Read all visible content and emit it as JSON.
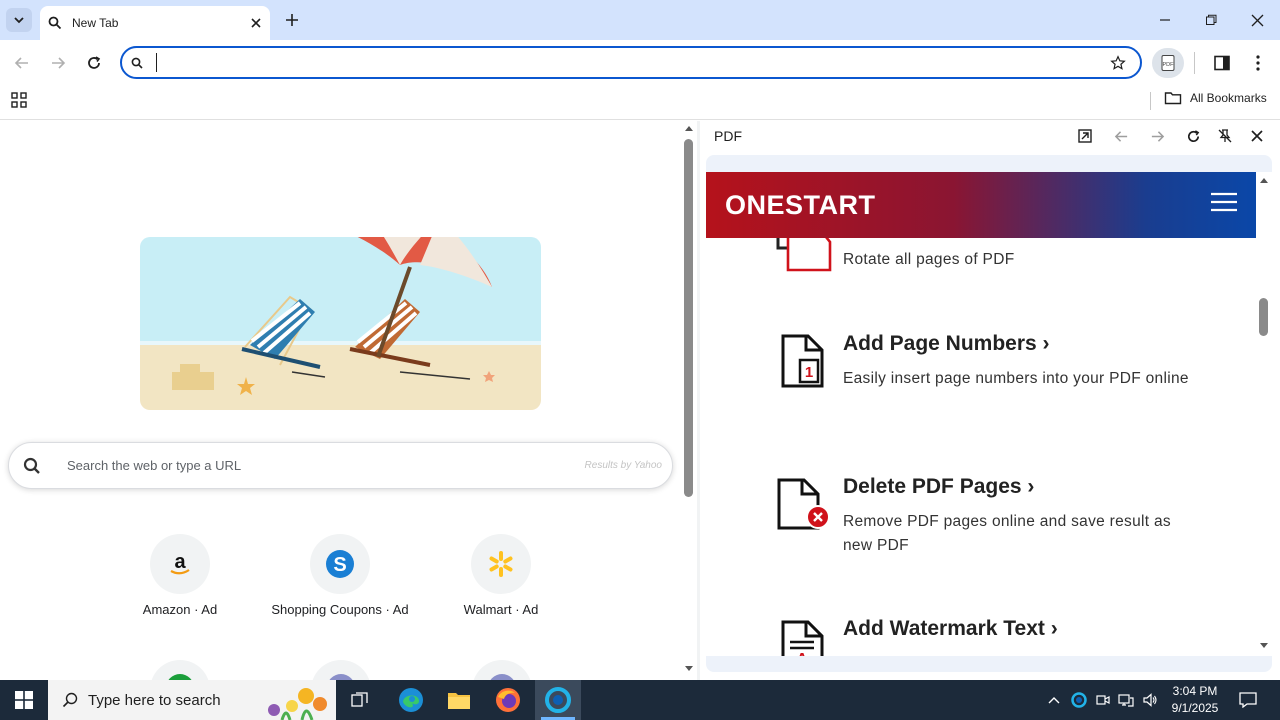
{
  "browser": {
    "tab_title": "New Tab",
    "omnibox_value": "",
    "bookmarks_label": "All Bookmarks"
  },
  "ntp": {
    "search_placeholder": "Search the web or type a URL",
    "search_by": "Results by Yahoo",
    "tiles": [
      {
        "label": "Amazon · Ad",
        "icon": "amazon-logo"
      },
      {
        "label": "Shopping Coupons · Ad",
        "icon": "shopping-coupons-logo"
      },
      {
        "label": "Walmart · Ad",
        "icon": "walmart-logo"
      }
    ]
  },
  "side_panel": {
    "title": "PDF",
    "site_logo": "ONESTART",
    "features": [
      {
        "title": "",
        "desc": "Rotate all pages of PDF"
      },
      {
        "title": "Add Page Numbers ›",
        "desc": "Easily insert page numbers into your PDF online"
      },
      {
        "title": "Delete PDF Pages ›",
        "desc": "Remove PDF pages online and save result as new PDF"
      },
      {
        "title": "Add Watermark Text ›",
        "desc": ""
      }
    ]
  },
  "taskbar": {
    "search_placeholder": "Type here to search",
    "time": "3:04 PM",
    "date": "9/1/2025"
  },
  "colors": {
    "omnibox_border": "#0b57d0",
    "titlebar": "#d3e3fd",
    "taskbar": "#1c2a3a",
    "brand_red": "#b5121b",
    "brand_blue": "#0a47a8"
  }
}
